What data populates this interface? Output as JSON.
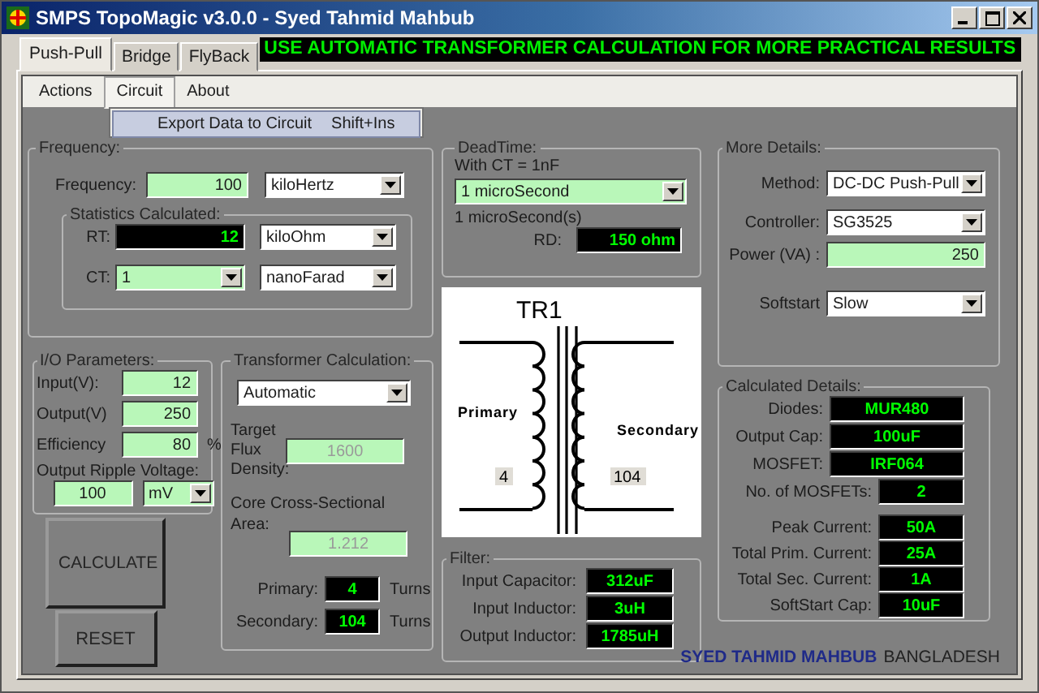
{
  "window": {
    "title": "SMPS TopoMagic v3.0.0 - Syed Tahmid Mahbub"
  },
  "banner": "USE AUTOMATIC TRANSFORMER CALCULATION FOR MORE PRACTICAL RESULTS",
  "tabs": [
    {
      "label": "Push-Pull",
      "selected": true
    },
    {
      "label": "Bridge",
      "selected": false
    },
    {
      "label": "FlyBack",
      "selected": false
    }
  ],
  "menu": [
    {
      "label": "Actions",
      "selected": false
    },
    {
      "label": "Circuit",
      "selected": true
    },
    {
      "label": "About",
      "selected": false
    }
  ],
  "menu_dropdown": [
    {
      "label": "Export Data to Circuit",
      "shortcut": "Shift+Ins"
    }
  ],
  "frequency": {
    "title": "Frequency:",
    "label": "Frequency:",
    "value": "100",
    "unit": "kiloHertz",
    "statistics": {
      "title": "Statistics Calculated:",
      "rt": {
        "label": "RT:",
        "value": "12",
        "unit": "kiloOhm"
      },
      "ct": {
        "label": "CT:",
        "value": "1",
        "unit": "nanoFarad"
      }
    }
  },
  "io_parameters": {
    "title": "I/O Parameters:",
    "fields": [
      {
        "label": "Input(V):",
        "value": "12"
      },
      {
        "label": "Output(V)",
        "value": "250"
      },
      {
        "label": "Efficiency",
        "value": "80",
        "suffix": "%"
      }
    ],
    "ripple": {
      "label": "Output Ripple Voltage:",
      "value": "100",
      "unit": "mV"
    }
  },
  "buttons": [
    {
      "label": "CALCULATE"
    },
    {
      "label": "RESET"
    }
  ],
  "transformer_calculation": {
    "title": "Transformer Calculation:",
    "mode": "Automatic",
    "flux": {
      "label": "Target Flux Density:",
      "value": "1600",
      "disabled": true
    },
    "core_area": {
      "label": "Core Cross-Sectional Area:",
      "value": "1.212",
      "disabled": true
    },
    "turns": [
      {
        "label": "Primary:",
        "value": "4",
        "unit": "Turns"
      },
      {
        "label": "Secondary:",
        "value": "104",
        "unit": "Turns"
      }
    ]
  },
  "dead_time": {
    "title": "DeadTime:",
    "note": "With CT = 1nF",
    "selection": "1 microSecond",
    "reading": "1 microSecond(s)",
    "rd": {
      "label": "RD:",
      "value": "150 ohm"
    }
  },
  "diagram": {
    "title": "TR1",
    "primary_label": "Primary",
    "secondary_label": "Secondary",
    "primary_turns": "4",
    "secondary_turns": "104"
  },
  "filter": {
    "title": "Filter:",
    "rows": [
      {
        "label": "Input Capacitor:",
        "value": "312uF"
      },
      {
        "label": "Input Inductor:",
        "value": "3uH"
      },
      {
        "label": "Output Inductor:",
        "value": "1785uH"
      }
    ]
  },
  "more_details": {
    "title": "More Details:",
    "rows": [
      {
        "kind": "dropdown",
        "label": "Method:",
        "value": "DC-DC Push-Pull"
      },
      {
        "kind": "dropdown",
        "label": "Controller:",
        "value": "SG3525"
      },
      {
        "kind": "input",
        "label": "Power (VA) :",
        "value": "250"
      },
      {
        "kind": "dropdown",
        "label": "Softstart",
        "value": "Slow"
      }
    ]
  },
  "calculated_details": {
    "title": "Calculated Details:",
    "parts": [
      {
        "kind": "wide",
        "label": "Diodes:",
        "value": "MUR480"
      },
      {
        "kind": "wide",
        "label": "Output Cap:",
        "value": "100uF"
      },
      {
        "kind": "wide",
        "label": "MOSFET:",
        "value": "IRF064"
      },
      {
        "kind": "narrow",
        "label": "No. of MOSFETs:",
        "value": "2"
      }
    ],
    "currents": [
      {
        "label": "Peak Current:",
        "value": "50A"
      },
      {
        "label": "Total Prim. Current:",
        "value": "25A"
      },
      {
        "label": "Total Sec. Current:",
        "value": "1A"
      },
      {
        "label": "SoftStart Cap:",
        "value": "10uF"
      }
    ]
  },
  "footer": {
    "name": "SYED TAHMID MAHBUB",
    "country": "BANGLADESH"
  }
}
